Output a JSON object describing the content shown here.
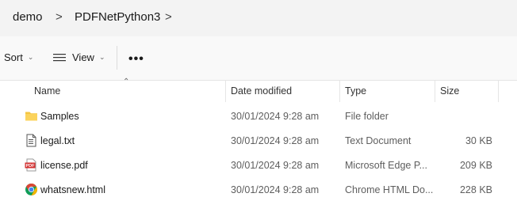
{
  "breadcrumb": {
    "items": [
      "demo",
      "PDFNetPython3"
    ],
    "separator": ">"
  },
  "toolbar": {
    "sort_label": "Sort",
    "view_label": "View",
    "more_label": "•••"
  },
  "columns": {
    "name": "Name",
    "date": "Date modified",
    "type": "Type",
    "size": "Size"
  },
  "files": [
    {
      "name": "Samples",
      "date": "30/01/2024 9:28 am",
      "type": "File folder",
      "size": "",
      "icon": "folder-icon"
    },
    {
      "name": "legal.txt",
      "date": "30/01/2024 9:28 am",
      "type": "Text Document",
      "size": "30 KB",
      "icon": "text-file-icon"
    },
    {
      "name": "license.pdf",
      "date": "30/01/2024 9:28 am",
      "type": "Microsoft Edge P...",
      "size": "209 KB",
      "icon": "pdf-icon"
    },
    {
      "name": "whatsnew.html",
      "date": "30/01/2024 9:28 am",
      "type": "Chrome HTML Do...",
      "size": "228 KB",
      "icon": "chrome-icon"
    }
  ],
  "colors": {
    "folder": "#f4c542",
    "pdf": "#d32f2f",
    "chrome_red": "#db4437",
    "chrome_yellow": "#f4b400",
    "chrome_green": "#0f9d58",
    "chrome_blue": "#4285f4"
  }
}
